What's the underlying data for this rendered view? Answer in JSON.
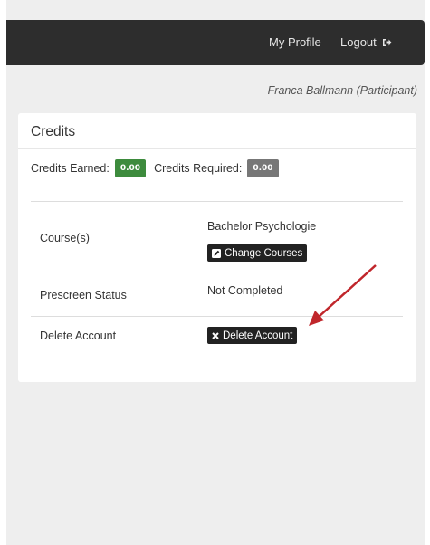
{
  "navbar": {
    "my_profile": "My Profile",
    "logout": "Logout",
    "logout_icon": "sign-out-icon",
    "background": "#2d2d2d"
  },
  "user": {
    "display": "Franca Ballmann (Participant)"
  },
  "credits_panel": {
    "title": "Credits",
    "earned_label": "Credits Earned:",
    "earned_value": "0.00",
    "earned_color": "#3d8b3d",
    "required_label": "Credits Required:",
    "required_value": "0.00",
    "required_color": "#777777"
  },
  "rows": {
    "courses": {
      "label": "Course(s)",
      "value": "Bachelor Psychologie",
      "button": "Change Courses",
      "button_icon": "edit-icon"
    },
    "prescreen": {
      "label": "Prescreen Status",
      "value": "Not Completed"
    },
    "delete": {
      "label": "Delete Account",
      "button": "Delete Account",
      "button_icon": "close-icon"
    }
  },
  "annotation": {
    "arrow_color": "#c0262b"
  }
}
